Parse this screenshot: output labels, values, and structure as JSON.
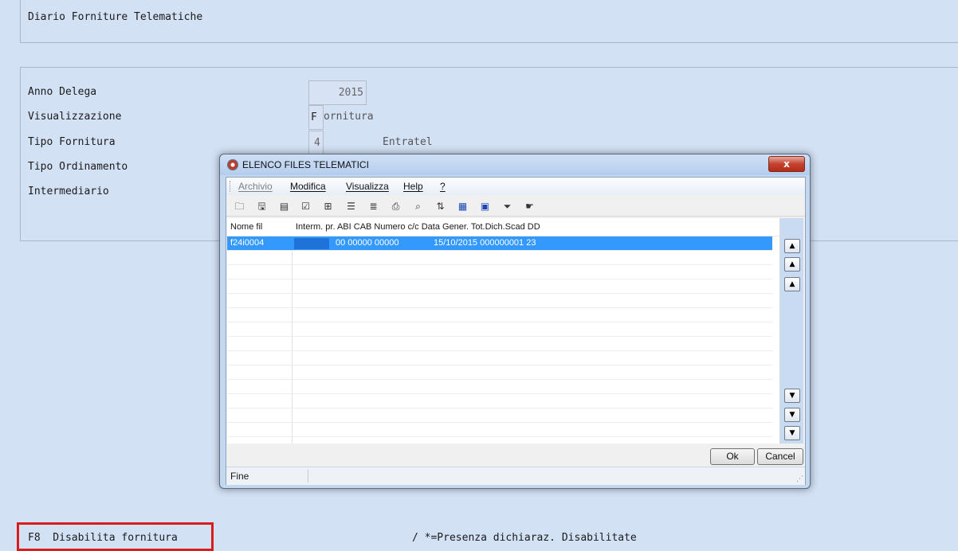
{
  "screen": {
    "title": "Diario Forniture Telematiche",
    "fields": {
      "anno_delega": {
        "label": "Anno Delega",
        "value": "2015"
      },
      "visualizzazione": {
        "label": "Visualizzazione",
        "value": "F",
        "desc": "ornitura"
      },
      "tipo_fornitura": {
        "label": "Tipo Fornitura",
        "value": "4",
        "desc": "Entratel"
      },
      "tipo_ordinamento": {
        "label": "Tipo Ordinamento"
      },
      "intermediario": {
        "label": "Intermediario"
      }
    },
    "footer": {
      "f8_label": "F8  Disabilita fornitura",
      "note": "/ *=Presenza dichiaraz. Disabilitate"
    }
  },
  "dialog": {
    "title": "ELENCO FILES TELEMATICI",
    "close_glyph": "x",
    "menu": [
      {
        "label": "Archivio",
        "enabled": false
      },
      {
        "label": "Modifica",
        "enabled": true
      },
      {
        "label": "Visualizza",
        "enabled": true
      },
      {
        "label": "Help",
        "enabled": true
      },
      {
        "label": "?",
        "enabled": true
      }
    ],
    "toolbar": [
      {
        "name": "open-folder-icon",
        "glyph": "🗀"
      },
      {
        "name": "save-icon",
        "glyph": "🖫"
      },
      {
        "name": "record-view-icon",
        "glyph": "▤"
      },
      {
        "name": "checklist-icon",
        "glyph": "☑"
      },
      {
        "name": "tree-icon",
        "glyph": "⊞"
      },
      {
        "name": "list-icon",
        "glyph": "☰"
      },
      {
        "name": "details-icon",
        "glyph": "≣"
      },
      {
        "name": "print-preview-icon",
        "glyph": "⎙"
      },
      {
        "name": "find-icon",
        "glyph": "⌕"
      },
      {
        "name": "sort-icon",
        "glyph": "⇅"
      },
      {
        "name": "calendar-icon",
        "glyph": "▦"
      },
      {
        "name": "card-icon",
        "glyph": "▣"
      },
      {
        "name": "filter-icon",
        "glyph": "⏷"
      },
      {
        "name": "pointer-icon",
        "glyph": "☛"
      }
    ],
    "columns": [
      "Nome fil",
      "Interm. pr. ABI  CAB  Numero c/c  Data Gener. Tot.Dich.Scad DD"
    ],
    "rows": [
      {
        "nome_file": "f24i0004",
        "rest": "00  00000 00000",
        "date_info": "15/10/2015  000000001 23",
        "selected": true
      }
    ],
    "scroll_buttons": [
      "first-page",
      "page-up",
      "line-up",
      "line-down",
      "page-down",
      "last-page"
    ],
    "buttons": {
      "ok": "Ok",
      "cancel": "Cancel"
    },
    "status": "Fine",
    "colors": {
      "selection": "#3399ff",
      "close_button": "#c4422e",
      "annotation": "#d91c1c"
    }
  }
}
